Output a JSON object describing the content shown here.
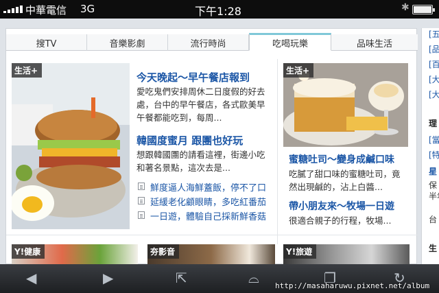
{
  "status_bar": {
    "carrier": "中華電信",
    "network": "3G",
    "time": "下午1:28"
  },
  "tabs": [
    {
      "label": "搜TV",
      "active": false
    },
    {
      "label": "音樂影劇",
      "active": false
    },
    {
      "label": "流行時尚",
      "active": false
    },
    {
      "label": "吃喝玩樂",
      "active": true
    },
    {
      "label": "品味生活",
      "active": false
    }
  ],
  "left_story": {
    "badge": "生活+",
    "headlines": [
      {
        "title": "今天晚起～早午餐店報到",
        "summary": [
          "愛吃鬼們安排周休二日度假的好去",
          "處，台中的早午餐店，各式歐美早",
          "午餐都能吃到，每周..."
        ]
      },
      {
        "title": "韓國度蜜月 跟團也好玩",
        "summary": [
          "想跟韓國團的請看這裡，街邊小吃",
          "和著名景點，這次去是..."
        ]
      }
    ],
    "links": [
      "鮮度逼人海鮮蓋飯，停不了口",
      "延緩老化顧眼睛，多吃紅番茄",
      "一日遊，體驗自己採新鮮香菇"
    ]
  },
  "right_story": {
    "badge": "生活+",
    "headlines": [
      {
        "title": "蜜糖吐司～變身成鹹口味",
        "summary": [
          "吃膩了甜口味的蜜糖吐司，竟",
          "然出現鹹的，沾上白醬..."
        ]
      },
      {
        "title": "帶小朋友來～牧場一日遊",
        "summary": [
          "很適合親子的行程，牧場..."
        ]
      }
    ]
  },
  "bottom_thumbs": [
    {
      "badge": "Y!健康"
    },
    {
      "badge": "夯影音"
    },
    {
      "badge": "Y!旅遊"
    }
  ],
  "sidebar": {
    "items": [
      "[五",
      "[品",
      "[百",
      "[大",
      "[大",
      "理",
      "[當",
      "[特",
      "星",
      "保",
      "半年",
      "台",
      "生"
    ]
  },
  "browser": {
    "url": "http://masaharuwu.pixnet.net/album"
  },
  "colors": {
    "link": "#1b56a6",
    "active_tab": "#7fc8d8"
  }
}
